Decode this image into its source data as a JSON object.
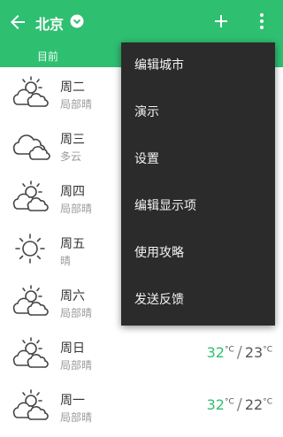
{
  "header": {
    "title": "北京",
    "back_icon": "arrow-left-icon",
    "dropdown_icon": "chevron-down-circle-icon",
    "add_icon": "plus-icon",
    "more_icon": "more-vert-icon",
    "subtitle": "目前"
  },
  "colors": {
    "accent": "#2fbf71",
    "menu_bg": "#2b2b2b"
  },
  "forecast": [
    {
      "day": "周二",
      "condition": "局部晴",
      "icon": "partly-sunny-icon",
      "high": "",
      "low": ""
    },
    {
      "day": "周三",
      "condition": "多云",
      "icon": "cloudy-icon",
      "high": "",
      "low": ""
    },
    {
      "day": "周四",
      "condition": "局部晴",
      "icon": "partly-sunny-icon",
      "high": "",
      "low": ""
    },
    {
      "day": "周五",
      "condition": "晴",
      "icon": "sunny-icon",
      "high": "",
      "low": ""
    },
    {
      "day": "周六",
      "condition": "局部晴",
      "icon": "partly-sunny-icon",
      "high": "",
      "low": ""
    },
    {
      "day": "周日",
      "condition": "局部晴",
      "icon": "partly-sunny-icon",
      "high": "32",
      "low": "23",
      "unit": "°C"
    },
    {
      "day": "周一",
      "condition": "局部晴",
      "icon": "partly-sunny-icon",
      "high": "32",
      "low": "22",
      "unit": "°C"
    }
  ],
  "menu": {
    "items": [
      "编辑城市",
      "演示",
      "设置",
      "编辑显示项",
      "使用攻略",
      "发送反馈"
    ]
  }
}
